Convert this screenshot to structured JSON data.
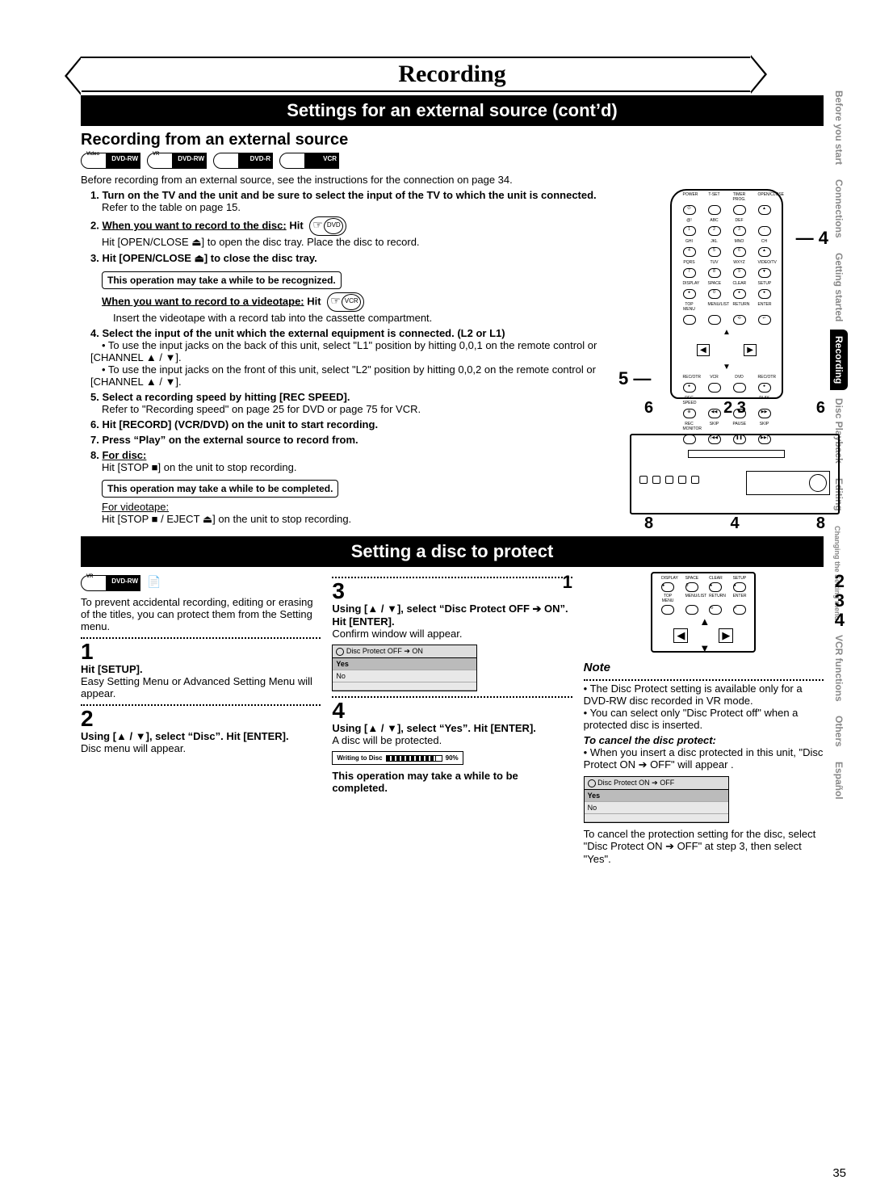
{
  "page_number": "35",
  "title": "Recording",
  "section1_bar": "Settings for an external source (cont’d)",
  "section1_subhead": "Recording from an external source",
  "formats": [
    {
      "top": "Video",
      "text": "DVD-RW"
    },
    {
      "top": "VR",
      "text": "DVD-RW"
    },
    {
      "top": "",
      "text": "DVD-R"
    },
    {
      "top": "",
      "text": "VCR"
    }
  ],
  "intro": "Before recording from an external source, see the instructions for the connection on page 34.",
  "steps": {
    "s1a": "1. Turn on the TV and the unit and be sure to select the input of the TV to which the unit is connected.",
    "s1b": "Refer to the table on page 15.",
    "s2a": "2. ",
    "s2a_u": "When you want to record to the disc:",
    "s2a_tail": " Hit ",
    "s2b": "Hit [OPEN/CLOSE ⏏] to open the disc tray. Place the disc to record.",
    "s3": "3. Hit [OPEN/CLOSE ⏏] to close the disc tray.",
    "notebox1": "This operation may take a while to be recognized.",
    "s_vcr_u": "When you want to record to a videotape:",
    "s_vcr_tail": " Hit ",
    "s_vcr_insert": "Insert the videotape with a record tab into the cassette compartment.",
    "s4a": "4. Select the input of the unit which the external equipment is connected. (L2 or L1)",
    "s4b": "• To use the input jacks on the back of this unit, select \"L1\" position by hitting 0,0,1 on the remote control or [CHANNEL ▲ / ▼].",
    "s4c": "• To use the input jacks on the front of this unit, select \"L2\" position by hitting 0,0,2 on the remote control or [CHANNEL ▲ / ▼].",
    "s5a": "5. Select a recording speed by hitting [REC SPEED].",
    "s5b": "Refer to \"Recording speed\" on page 25 for DVD or page 75 for VCR.",
    "s6": "6. Hit [RECORD] (VCR/DVD) on the unit to start recording.",
    "s7": "7. Press “Play” on the external source to record from.",
    "s8a": "8. ",
    "s8a_u": "For disc:",
    "s8b": "Hit [STOP ■] on the unit to stop recording.",
    "notebox2": "This operation may take a while to be completed.",
    "s8c_u": "For videotape:",
    "s8d": "Hit [STOP ■ / EJECT ⏏] on the unit to stop recording."
  },
  "remote_callouts": {
    "r4": "4",
    "r5": "5"
  },
  "unit_callouts": {
    "t1": "6",
    "t2": "2 3",
    "t3": "6",
    "b1": "8",
    "b2": "4",
    "b3": "8"
  },
  "section2_bar": "Setting a disc to protect",
  "protect_format": {
    "top": "VR",
    "text": "DVD-RW"
  },
  "protect_intro": "To prevent accidental recording, editing or erasing of the titles, you can protect them from the Setting menu.",
  "protect_steps": {
    "n1": "1",
    "h1": "Hit [SETUP].",
    "b1": "Easy Setting Menu or Advanced Setting Menu will appear.",
    "n2": "2",
    "h2": "Using [▲ / ▼], select “Disc”. Hit [ENTER].",
    "b2": "Disc menu will appear.",
    "n3": "3",
    "h3": "Using [▲ / ▼], select “Disc Protect OFF ➔ ON”. Hit [ENTER].",
    "b3": "Confirm window will appear.",
    "n4": "4",
    "h4": "Using [▲ / ▼], select “Yes”. Hit [ENTER].",
    "b4": "A disc will be protected.",
    "end": "This operation may take a while to be completed."
  },
  "osd1": {
    "title": "Disc Protect OFF ➔ ON",
    "yes": "Yes",
    "no": "No"
  },
  "progress": {
    "label": "Writing to Disc",
    "pct": "90%"
  },
  "note": {
    "head": "Note",
    "l1": "• The Disc Protect setting is available only for a DVD-RW disc recorded in VR mode.",
    "l2": "• You can select only \"Disc Protect off\" when a protected disc is inserted.",
    "cancel_head": "To cancel the disc protect:",
    "l3": "• When you insert a disc protected in this unit, \"Disc Protect ON ➔ OFF\" will appear .",
    "osd2_title": "Disc Protect ON ➔ OFF",
    "osd2_yes": "Yes",
    "osd2_no": "No",
    "l4": "To cancel the protection setting for the disc, select \"Disc Protect ON ➔ OFF\" at step 3, then select \"Yes\"."
  },
  "side_tabs": [
    "Before you start",
    "Connections",
    "Getting started",
    "Recording",
    "Disc Playback",
    "Editing",
    "Changing the Setting menu",
    "VCR functions",
    "Others",
    "Español"
  ],
  "side_active_index": 3,
  "protect_callouts": {
    "left": "1",
    "r1": "2",
    "r2": "3",
    "r3": "4"
  },
  "remote_labels": {
    "row1": [
      "POWER",
      "T-SET",
      "TIMER PROG.",
      "OPEN/CLOSE"
    ],
    "row2l": [
      "@!",
      "ABC",
      "DEF",
      ""
    ],
    "row2n": [
      "1",
      "2",
      "3",
      "·"
    ],
    "row3l": [
      "GHI",
      "JKL",
      "MNO",
      "CH"
    ],
    "row3n": [
      "4",
      "5",
      "6",
      "▲"
    ],
    "row4l": [
      "PQRS",
      "TUV",
      "WXYZ",
      "VIDEO/TV"
    ],
    "row4n": [
      "7",
      "8",
      "9",
      "▼"
    ],
    "row5l": [
      "DISPLAY",
      "SPACE",
      "CLEAR",
      "SETUP"
    ],
    "row5n": [
      "●",
      "0",
      "●",
      "●"
    ],
    "row6l": [
      "TOP MENU",
      "MENU/LIST",
      "RETURN",
      "ENTER"
    ],
    "row7l": [
      "REC/OTR",
      "VCR",
      "DVD",
      "REC/OTR"
    ],
    "row8l": [
      "REC SPEED",
      "",
      "",
      "PLAY"
    ],
    "row9l": [
      "REC MONITOR",
      "SKIP",
      "PAUSE",
      "SKIP"
    ]
  },
  "remote_sm_labels": {
    "row1l": [
      "DISPLAY",
      "SPACE",
      "CLEAR",
      "SETUP"
    ],
    "row2l": [
      "TOP MENU",
      "MENU/LIST",
      "RETURN",
      "ENTER"
    ]
  }
}
